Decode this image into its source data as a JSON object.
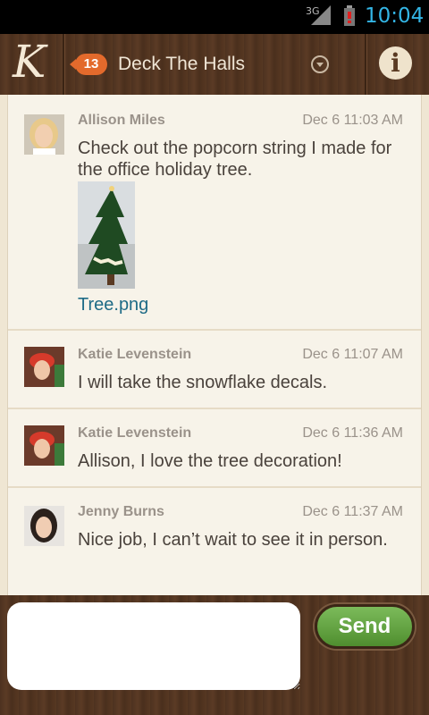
{
  "status_bar": {
    "network": "3G",
    "time": "10:04"
  },
  "header": {
    "logo_letter": "K",
    "unread_count": "13",
    "conversation_title": "Deck The Halls",
    "info_label": "i"
  },
  "messages": [
    {
      "sender": "Allison Miles",
      "time": "Dec 6 11:03 AM",
      "text": "Check out the popcorn string I made for the office holiday tree.",
      "attachment": "Tree.png"
    },
    {
      "sender": "Katie Levenstein",
      "time": "Dec 6 11:07 AM",
      "text": "I will take the snowflake decals."
    },
    {
      "sender": "Katie Levenstein",
      "time": "Dec 6 11:36 AM",
      "text": "Allison, I love the tree decoration!"
    },
    {
      "sender": "Jenny Burns",
      "time": "Dec 6 11:37 AM",
      "text": "Nice job, I can’t wait to see it in person."
    }
  ],
  "compose": {
    "input_value": "",
    "placeholder": "",
    "send_label": "Send"
  },
  "colors": {
    "accent_blue": "#33b5e5",
    "badge_orange": "#e36a2c",
    "send_green": "#5f9f3c",
    "link_teal": "#1e6b86",
    "wood_brown": "#5a3a22"
  }
}
